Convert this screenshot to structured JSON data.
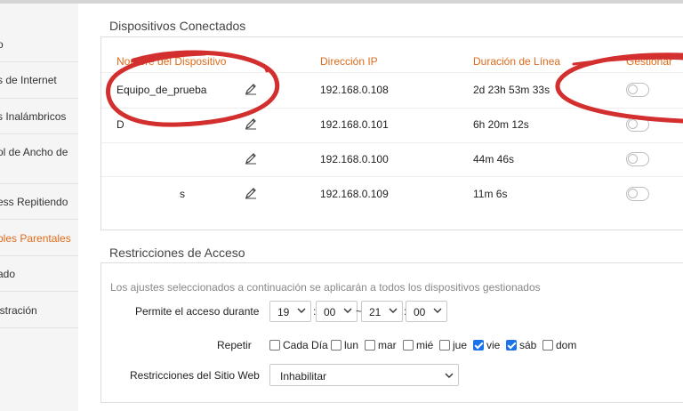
{
  "sidebar": {
    "items": [
      {
        "label": "o",
        "active": false
      },
      {
        "label": "s de Internet",
        "active": false
      },
      {
        "label": "s Inalámbricos",
        "active": false
      },
      {
        "label": "ol de Ancho de",
        "active": false
      },
      {
        "label": "ess Repitiendo",
        "active": false
      },
      {
        "label": "bles Parentales",
        "active": true
      },
      {
        "label": "ado",
        "active": false
      },
      {
        "label": "istración",
        "active": false
      }
    ]
  },
  "devices": {
    "title": "Dispositivos Conectados",
    "headers": {
      "name": "Nombre del Dispositivo",
      "ip": "Dirección IP",
      "duration": "Duración de Línea",
      "manage": "Gestionar"
    },
    "rows": [
      {
        "name": "Equipo_de_prueba",
        "ip": "192.168.0.108",
        "duration": "2d 23h 53m 33s",
        "managed": false
      },
      {
        "name": "D",
        "ip": "192.168.0.101",
        "duration": "6h 20m 12s",
        "managed": false
      },
      {
        "name": "",
        "ip": "192.168.0.100",
        "duration": "44m 46s",
        "managed": false
      },
      {
        "name": "s",
        "ip": "192.168.0.109",
        "duration": "11m 6s",
        "managed": false
      }
    ]
  },
  "access": {
    "title": "Restricciones de Acceso",
    "note": "Los ajustes seleccionados a continuación se aplicarán a todos los dispositivos gestionados",
    "allow_label": "Permite el acceso durante",
    "start_hour": "19",
    "start_min": "00",
    "end_hour": "21",
    "end_min": "00",
    "separator": "~",
    "colon": ":",
    "repeat_label": "Repetir",
    "days": [
      {
        "label": "Cada Día",
        "checked": false
      },
      {
        "label": "lun",
        "checked": false
      },
      {
        "label": "mar",
        "checked": false
      },
      {
        "label": "mié",
        "checked": false
      },
      {
        "label": "jue",
        "checked": false
      },
      {
        "label": "vie",
        "checked": true
      },
      {
        "label": "sáb",
        "checked": true
      },
      {
        "label": "dom",
        "checked": false
      }
    ],
    "website_label": "Restricciones del Sitio Web",
    "website_value": "Inhabilitar"
  },
  "colors": {
    "accent": "#e06b1a",
    "annotation": "#d32f2f",
    "checkbox": "#1a73e8"
  }
}
